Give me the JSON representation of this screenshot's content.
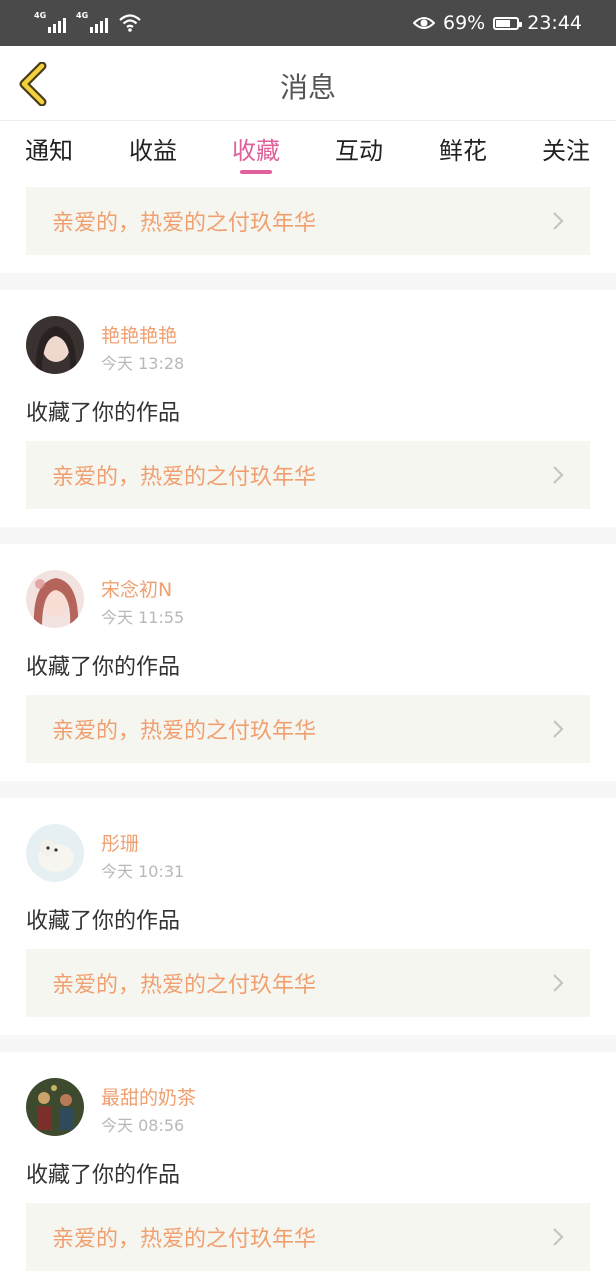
{
  "status_bar": {
    "network_1": "4G",
    "network_2": "4G",
    "battery_percent": "69%",
    "battery_level": 0.69,
    "time": "23:44"
  },
  "header": {
    "title": "消息",
    "back_icon": "chevron-left-icon"
  },
  "tabs": [
    {
      "label": "通知",
      "active": false
    },
    {
      "label": "收益",
      "active": false
    },
    {
      "label": "收藏",
      "active": true
    },
    {
      "label": "互动",
      "active": false
    },
    {
      "label": "鲜花",
      "active": false
    },
    {
      "label": "关注",
      "active": false
    }
  ],
  "top_item": {
    "work_title": "亲爱的，热爱的之付玖年华"
  },
  "messages": [
    {
      "user": "艳艳艳艳",
      "time": "今天 13:28",
      "action": "收藏了你的作品",
      "work_title": "亲爱的，热爱的之付玖年华"
    },
    {
      "user": "宋念初N",
      "time": "今天 11:55",
      "action": "收藏了你的作品",
      "work_title": "亲爱的，热爱的之付玖年华"
    },
    {
      "user": "彤珊",
      "time": "今天 10:31",
      "action": "收藏了你的作品",
      "work_title": "亲爱的，热爱的之付玖年华"
    },
    {
      "user": "最甜的奶茶",
      "time": "今天 08:56",
      "action": "收藏了你的作品",
      "work_title": "亲爱的，热爱的之付玖年华"
    }
  ],
  "colors": {
    "accent": "#e0609c",
    "link_text": "#f0a070",
    "card_bg": "#f6f6f1",
    "status_bar": "#4a4a4a"
  }
}
